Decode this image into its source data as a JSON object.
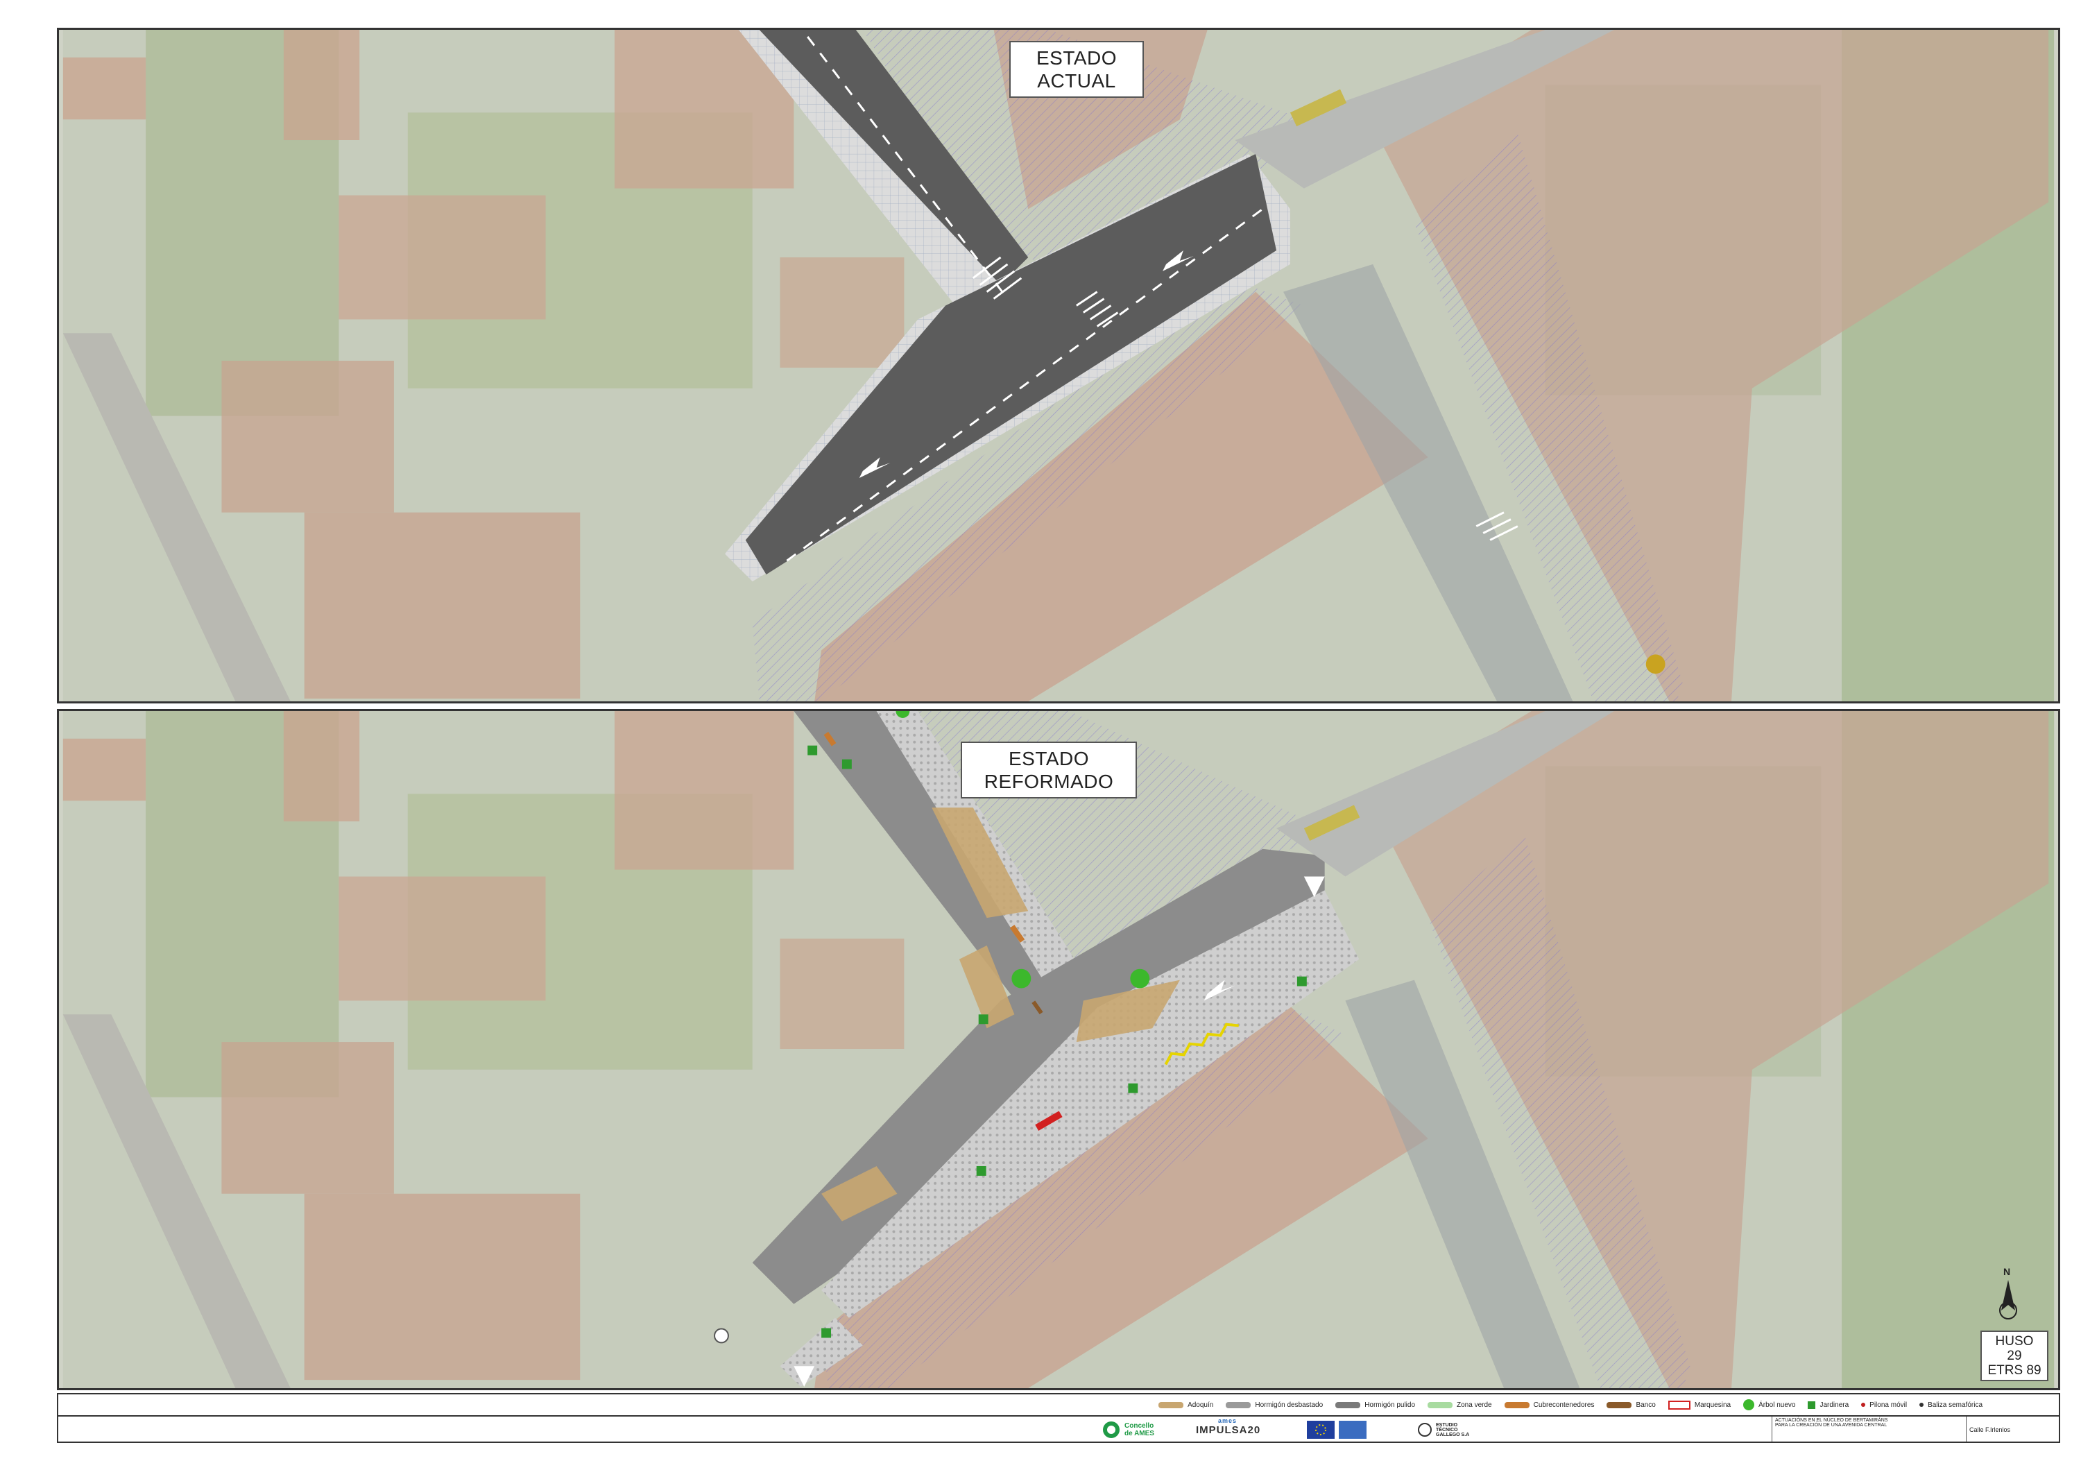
{
  "panels": {
    "actual": {
      "label_line1": "ESTADO",
      "label_line2": "ACTUAL"
    },
    "reform": {
      "label_line1": "ESTADO",
      "label_line2": "REFORMADO"
    }
  },
  "projection": {
    "line1": "HUSO 29",
    "line2": "ETRS 89"
  },
  "north_label": "N",
  "legend": [
    {
      "label": "Adoquín",
      "color": "#c8a670",
      "kind": "bar"
    },
    {
      "label": "Hormigón desbastado",
      "color": "#9a9a9a",
      "kind": "bar"
    },
    {
      "label": "Hormigón pulido",
      "color": "#7a7a7a",
      "kind": "bar"
    },
    {
      "label": "Zona verde",
      "color": "#a8dba0",
      "kind": "bar"
    },
    {
      "label": "Cubrecontenedores",
      "color": "#c87a30",
      "kind": "bar"
    },
    {
      "label": "Banco",
      "color": "#8a5a2a",
      "kind": "bar"
    },
    {
      "label": "Marquesina",
      "color": "#d22020",
      "kind": "outline"
    },
    {
      "label": "Árbol nuevo",
      "color": "#3cb82c",
      "kind": "tree"
    },
    {
      "label": "Jardinera",
      "color": "#2e9a2e",
      "kind": "square"
    },
    {
      "label": "Pilona móvil",
      "color": "#c02020",
      "kind": "dot"
    },
    {
      "label": "Baliza semafórica",
      "color": "#333333",
      "kind": "dot"
    }
  ],
  "title_block": {
    "logo1_line1": "Concello",
    "logo1_line2": "de AMES",
    "logo2": "IMPULSA20",
    "logo2_sup": "ames",
    "project_title": "ACTUACIÓNS EN EL NÚCLEO DE BERTAMIRÁNS PARA LA CREACIÓN DE UNA AVENIDA CENTRAL",
    "plan_title": "Calle F.Irlenlos",
    "company": "ESTUDIO TÉCNICO GALLEGO S.A"
  },
  "colors": {
    "road_asphalt": "#5f5f5f",
    "road_reform": "#8c8c8c",
    "sidewalk": "#d8d8d8",
    "hatch": "#8877cc",
    "roof": "#c9a695",
    "green": "#b7c4a2"
  }
}
